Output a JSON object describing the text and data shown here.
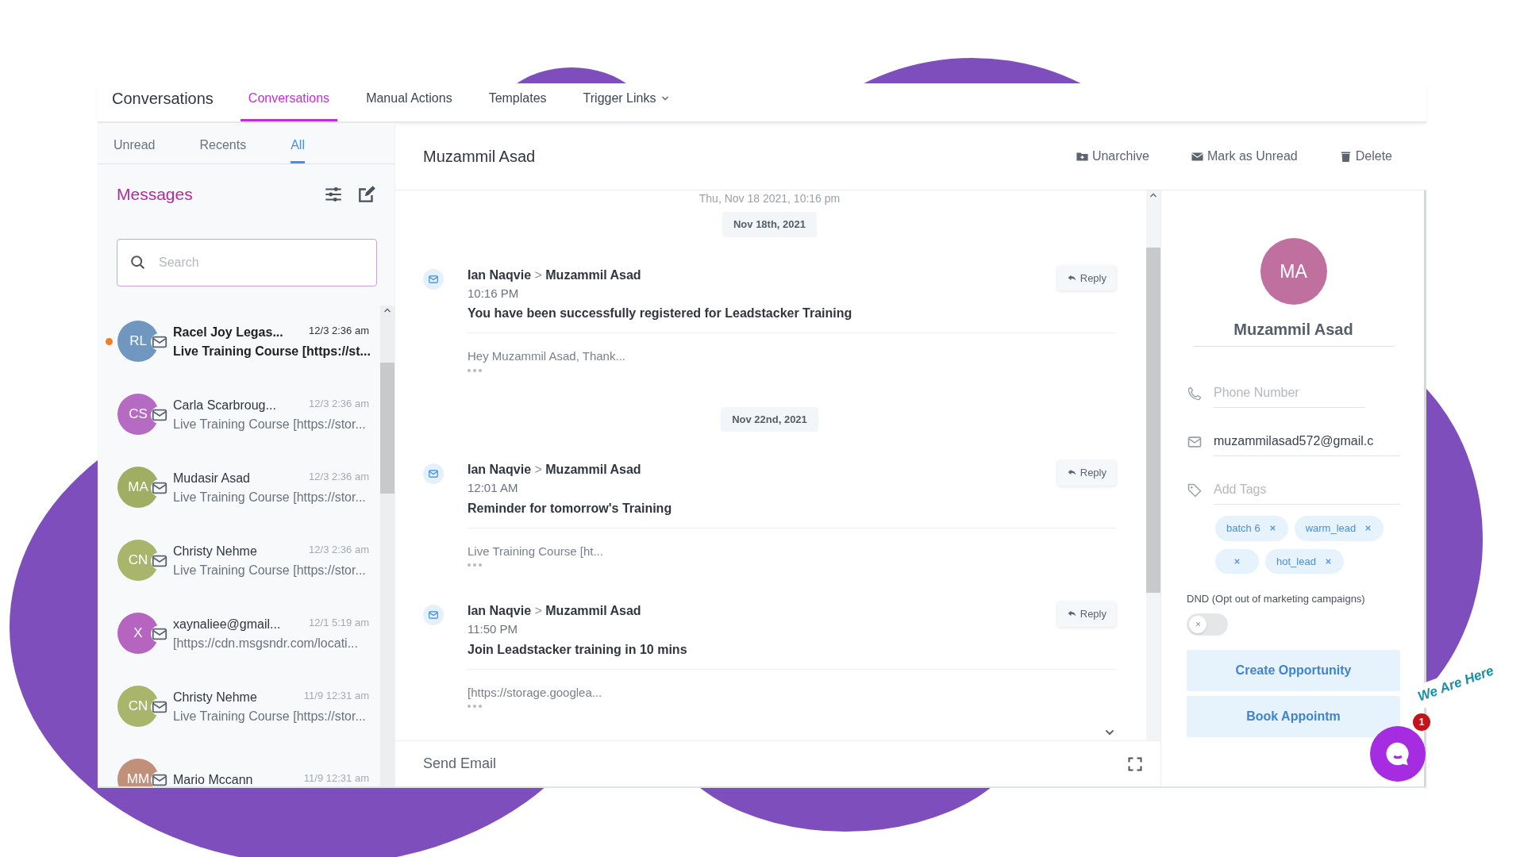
{
  "nav": {
    "title": "Conversations",
    "tabs": [
      {
        "label": "Conversations",
        "selected": true
      },
      {
        "label": "Manual Actions",
        "selected": false
      },
      {
        "label": "Templates",
        "selected": false
      },
      {
        "label": "Trigger Links",
        "selected": false,
        "kind": "dropdown"
      }
    ]
  },
  "sidebar": {
    "filters": [
      {
        "label": "Unread",
        "selected": false
      },
      {
        "label": "Recents",
        "selected": false
      },
      {
        "label": "All",
        "selected": true
      }
    ],
    "title": "Messages",
    "search": {
      "placeholder": "Search"
    },
    "conversations": [
      {
        "initials": "RL",
        "color": "#6f97c0",
        "name": "Racel Joy Legas...",
        "time": "12/3 2:36 am",
        "preview": "Live Training Course [https://st...",
        "unread": true
      },
      {
        "initials": "CS",
        "color": "#b56bc2",
        "name": "Carla Scarbroug...",
        "time": "12/3 2:36 am",
        "preview": "Live Training Course [https://stor...",
        "unread": false
      },
      {
        "initials": "MA",
        "color": "#9fae62",
        "name": "Mudasir Asad",
        "time": "12/3 2:36 am",
        "preview": "Live Training Course [https://stor...",
        "unread": false
      },
      {
        "initials": "CN",
        "color": "#a9b56a",
        "name": "Christy Nehme",
        "time": "12/3 2:36 am",
        "preview": "Live Training Course [https://stor...",
        "unread": false
      },
      {
        "initials": "X",
        "color": "#b565c0",
        "name": "xaynaliee@gmail...",
        "time": "12/1 5:19 am",
        "preview": "[https://cdn.msgsndr.com/locati...",
        "unread": false
      },
      {
        "initials": "CN",
        "color": "#a9b56a",
        "name": "Christy Nehme",
        "time": "11/9 12:31 am",
        "preview": "Live Training Course [https://stor...",
        "unread": false
      },
      {
        "initials": "MM",
        "color": "#c0907a",
        "name": "Mario Mccann",
        "time": "11/9 12:31 am",
        "unread": false
      }
    ]
  },
  "conversation": {
    "title": "Muzammil Asad",
    "actions": [
      {
        "label": "Unarchive",
        "kind": "archive"
      },
      {
        "label": "Mark as Unread",
        "kind": "mail"
      },
      {
        "label": "Delete",
        "kind": "trash"
      }
    ],
    "items": [
      {
        "kind": "timestamp",
        "text": "Thu, Nov 18 2021, 10:16 pm"
      },
      {
        "kind": "date",
        "text": "Nov 18th, 2021"
      },
      {
        "kind": "message",
        "from": "Ian Naqvie",
        "separator": ">",
        "to": "Muzammil Asad",
        "time": "10:16 PM",
        "subject": "You have been successfully registered for Leadstacker Training",
        "snippet": "Hey Muzammil Asad, Thank...",
        "reply": "Reply"
      },
      {
        "kind": "date",
        "text": "Nov 22nd, 2021"
      },
      {
        "kind": "message",
        "from": "Ian Naqvie",
        "separator": ">",
        "to": "Muzammil Asad",
        "time": "12:01 AM",
        "subject": "Reminder for tomorrow's Training",
        "snippet": "Live Training Course [ht...",
        "reply": "Reply"
      },
      {
        "kind": "message",
        "from": "Ian Naqvie",
        "separator": ">",
        "to": "Muzammil Asad",
        "time": "11:50 PM",
        "subject": "Join Leadstacker training in 10 mins",
        "snippet": "[https://storage.googlea...",
        "reply": "Reply"
      }
    ],
    "composer": {
      "label": "Send Email"
    }
  },
  "contact": {
    "initials": "MA",
    "name": "Muzammil Asad",
    "phone": {
      "placeholder": "Phone Number"
    },
    "email": "muzammilasad572@gmail.c",
    "tags_field": {
      "placeholder": "Add Tags"
    },
    "tags": [
      {
        "kind": "labeled",
        "label": "batch 6"
      },
      {
        "kind": "labeled",
        "label": "warm_lead"
      },
      {
        "kind": "blank"
      },
      {
        "kind": "labeled",
        "label": "hot_lead"
      }
    ],
    "dnd": {
      "label": "DND (Opt out of marketing campaigns)",
      "on": false
    },
    "buttons": [
      "Create Opportunity",
      "Book Appointm"
    ]
  },
  "chat_widget": {
    "caption": "We Are Here",
    "badge": "1"
  }
}
